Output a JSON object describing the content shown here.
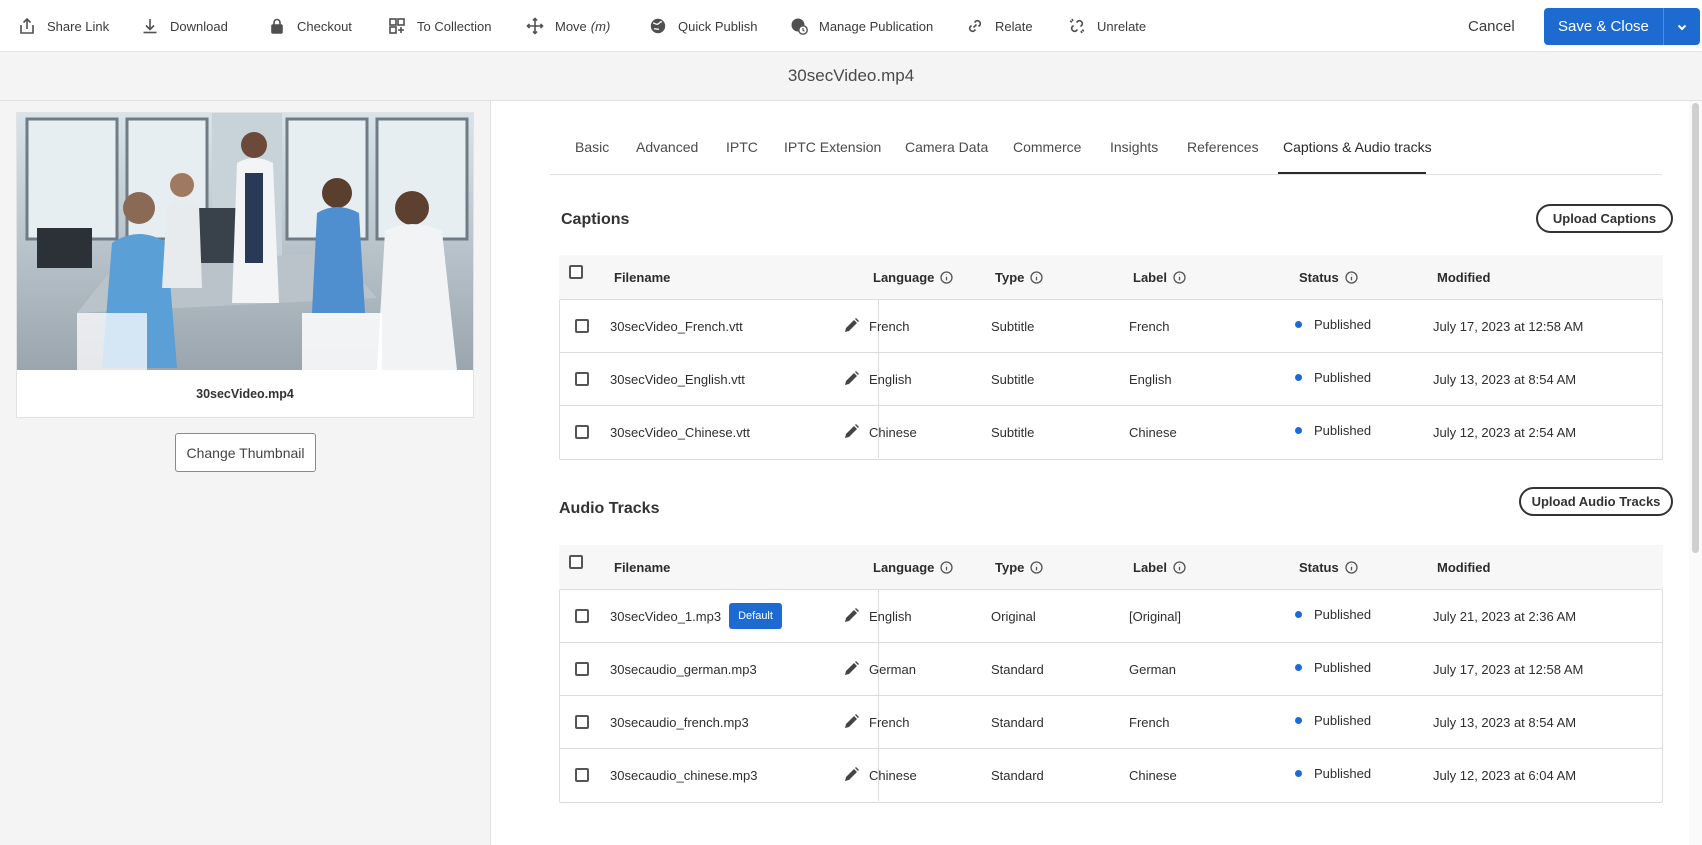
{
  "toolbar": {
    "items": [
      {
        "label": "Share Link",
        "icon": "share-icon"
      },
      {
        "label": "Download",
        "icon": "download-icon"
      },
      {
        "label": "Checkout",
        "icon": "lock-icon"
      },
      {
        "label": "To Collection",
        "icon": "collection-icon"
      },
      {
        "label": "Move",
        "shortcut": "(m)",
        "icon": "move-icon"
      },
      {
        "label": "Quick Publish",
        "icon": "globe-icon"
      },
      {
        "label": "Manage Publication",
        "icon": "globe-clock-icon"
      },
      {
        "label": "Relate",
        "icon": "link-icon"
      },
      {
        "label": "Unrelate",
        "icon": "unlink-icon"
      }
    ],
    "cancel_label": "Cancel",
    "save_label": "Save & Close"
  },
  "title": "30secVideo.mp4",
  "asset": {
    "name": "30secVideo.mp4",
    "change_thumbnail_label": "Change Thumbnail"
  },
  "tabs": [
    "Basic",
    "Advanced",
    "IPTC",
    "IPTC Extension",
    "Camera Data",
    "Commerce",
    "Insights",
    "References",
    "Captions & Audio tracks"
  ],
  "active_tab": "Captions & Audio tracks",
  "columns": {
    "filename": "Filename",
    "language": "Language",
    "type": "Type",
    "label": "Label",
    "status": "Status",
    "modified": "Modified"
  },
  "captions": {
    "title": "Captions",
    "upload_label": "Upload Captions",
    "rows": [
      {
        "filename": "30secVideo_French.vtt",
        "language": "French",
        "type": "Subtitle",
        "label": "French",
        "status": "Published",
        "modified": "July 17, 2023 at 12:58 AM"
      },
      {
        "filename": "30secVideo_English.vtt",
        "language": "English",
        "type": "Subtitle",
        "label": "English",
        "status": "Published",
        "modified": "July 13, 2023 at 8:54 AM"
      },
      {
        "filename": "30secVideo_Chinese.vtt",
        "language": "Chinese",
        "type": "Subtitle",
        "label": "Chinese",
        "status": "Published",
        "modified": "July 12, 2023 at 2:54 AM"
      }
    ]
  },
  "audio": {
    "title": "Audio Tracks",
    "upload_label": "Upload Audio Tracks",
    "default_badge": "Default",
    "rows": [
      {
        "filename": "30secVideo_1.mp3",
        "language": "English",
        "type": "Original",
        "label": "[Original]",
        "status": "Published",
        "modified": "July 21, 2023 at 2:36 AM",
        "default": true
      },
      {
        "filename": "30secaudio_german.mp3",
        "language": "German",
        "type": "Standard",
        "label": "German",
        "status": "Published",
        "modified": "July 17, 2023 at 12:58 AM"
      },
      {
        "filename": "30secaudio_french.mp3",
        "language": "French",
        "type": "Standard",
        "label": "French",
        "status": "Published",
        "modified": "July 13, 2023 at 8:54 AM"
      },
      {
        "filename": "30secaudio_chinese.mp3",
        "language": "Chinese",
        "type": "Standard",
        "label": "Chinese",
        "status": "Published",
        "modified": "July 12, 2023 at 6:04 AM"
      }
    ]
  },
  "colors": {
    "accent": "#1d6bd0",
    "status_published": "#1d6bd0"
  }
}
